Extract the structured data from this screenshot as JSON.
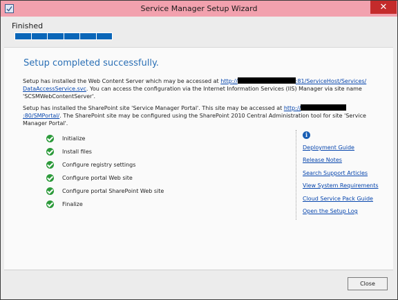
{
  "window": {
    "title": "Service Manager Setup Wizard",
    "close_glyph": "✕"
  },
  "header": {
    "stage_label": "Finished",
    "progress_fraction": 1.0
  },
  "main": {
    "headline": "Setup completed successfully.",
    "p1": {
      "t1": "Setup has installed the Web Content Server which may be accessed at ",
      "link_a": "http://",
      "link_b": ":81/ServiceHost/Services/",
      "link_c": "DataAccessService.svc",
      "t2": ". You can access the configuration via the Internet Information Services (IIS) Manager via site name 'SCSMWebContentServer'."
    },
    "p2": {
      "t1": "Setup has installed the SharePoint site 'Service Manager Portal'. This site may be accessed at ",
      "link_a": "http://",
      "link_b": ":80/SMPortal/",
      "t2": ". The SharePoint site may be configured using the SharePoint 2010 Central Administration tool for site 'Service Manager Portal'."
    },
    "steps": [
      {
        "label": "Initialize"
      },
      {
        "label": "Install files"
      },
      {
        "label": "Configure registry settings"
      },
      {
        "label": "Configure portal Web site"
      },
      {
        "label": "Configure portal SharePoint Web site"
      },
      {
        "label": "Finalize"
      }
    ],
    "help_icon": "info-icon",
    "help_links": [
      {
        "label": "Deployment Guide"
      },
      {
        "label": "Release Notes"
      },
      {
        "label": "Search Support Articles"
      },
      {
        "label": "View System Requirements"
      },
      {
        "label": "Cloud Service Pack Guide"
      },
      {
        "label": "Open the Setup Log"
      }
    ]
  },
  "footer": {
    "close_label": "Close"
  },
  "colors": {
    "titlebar": "#f2a1ae",
    "accent": "#0a66b8",
    "headline": "#2a6fb5",
    "success": "#2c9a3a",
    "link": "#0645ad"
  }
}
